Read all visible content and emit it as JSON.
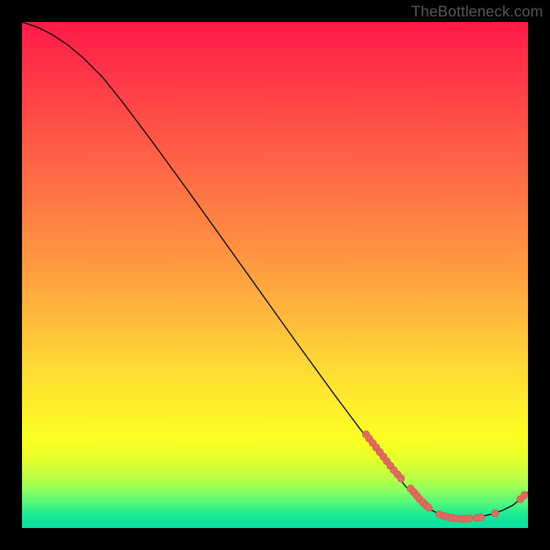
{
  "attribution": "TheBottleneck.com",
  "colors": {
    "curve_stroke": "#000000",
    "marker_fill": "#e06b5f",
    "marker_stroke": "#cc5a4e",
    "background": "#000000"
  },
  "chart_data": {
    "type": "line",
    "title": "",
    "xlabel": "",
    "ylabel": "",
    "xlim": [
      0,
      100
    ],
    "ylim": [
      0,
      100
    ],
    "curve": [
      {
        "x": 0,
        "y": 100
      },
      {
        "x": 3,
        "y": 99
      },
      {
        "x": 6,
        "y": 97.5
      },
      {
        "x": 9,
        "y": 95.5
      },
      {
        "x": 12,
        "y": 93
      },
      {
        "x": 16,
        "y": 89
      },
      {
        "x": 20,
        "y": 84
      },
      {
        "x": 26,
        "y": 76
      },
      {
        "x": 34,
        "y": 65
      },
      {
        "x": 44,
        "y": 51
      },
      {
        "x": 54,
        "y": 37
      },
      {
        "x": 62,
        "y": 26
      },
      {
        "x": 68,
        "y": 18
      },
      {
        "x": 72,
        "y": 13
      },
      {
        "x": 76,
        "y": 8
      },
      {
        "x": 79,
        "y": 5
      },
      {
        "x": 81,
        "y": 3.5
      },
      {
        "x": 83,
        "y": 2.5
      },
      {
        "x": 85,
        "y": 2
      },
      {
        "x": 87,
        "y": 1.8
      },
      {
        "x": 89,
        "y": 2
      },
      {
        "x": 91,
        "y": 2.3
      },
      {
        "x": 93,
        "y": 2.8
      },
      {
        "x": 95,
        "y": 3.5
      },
      {
        "x": 97,
        "y": 4.5
      },
      {
        "x": 98.5,
        "y": 5.7
      },
      {
        "x": 100,
        "y": 7
      }
    ],
    "markers": [
      {
        "x": 68.0,
        "y": 18.5
      },
      {
        "x": 68.6,
        "y": 17.7
      },
      {
        "x": 69.3,
        "y": 16.8
      },
      {
        "x": 70.0,
        "y": 15.9
      },
      {
        "x": 70.7,
        "y": 15.0
      },
      {
        "x": 71.4,
        "y": 14.1
      },
      {
        "x": 72.1,
        "y": 13.2
      },
      {
        "x": 72.8,
        "y": 12.3
      },
      {
        "x": 73.5,
        "y": 11.4
      },
      {
        "x": 74.2,
        "y": 10.6
      },
      {
        "x": 74.9,
        "y": 9.8
      },
      {
        "x": 76.8,
        "y": 7.8
      },
      {
        "x": 77.4,
        "y": 7.1
      },
      {
        "x": 78.0,
        "y": 6.4
      },
      {
        "x": 78.6,
        "y": 5.7
      },
      {
        "x": 79.2,
        "y": 5.1
      },
      {
        "x": 79.8,
        "y": 4.5
      },
      {
        "x": 80.4,
        "y": 4.0
      },
      {
        "x": 82.5,
        "y": 2.7
      },
      {
        "x": 83.3,
        "y": 2.4
      },
      {
        "x": 84.1,
        "y": 2.2
      },
      {
        "x": 84.9,
        "y": 2.0
      },
      {
        "x": 85.7,
        "y": 1.9
      },
      {
        "x": 86.8,
        "y": 1.8
      },
      {
        "x": 87.6,
        "y": 1.8
      },
      {
        "x": 88.4,
        "y": 1.9
      },
      {
        "x": 89.9,
        "y": 2.0
      },
      {
        "x": 90.7,
        "y": 2.1
      },
      {
        "x": 93.5,
        "y": 2.9
      },
      {
        "x": 98.5,
        "y": 5.7
      },
      {
        "x": 99.3,
        "y": 6.5
      }
    ]
  }
}
